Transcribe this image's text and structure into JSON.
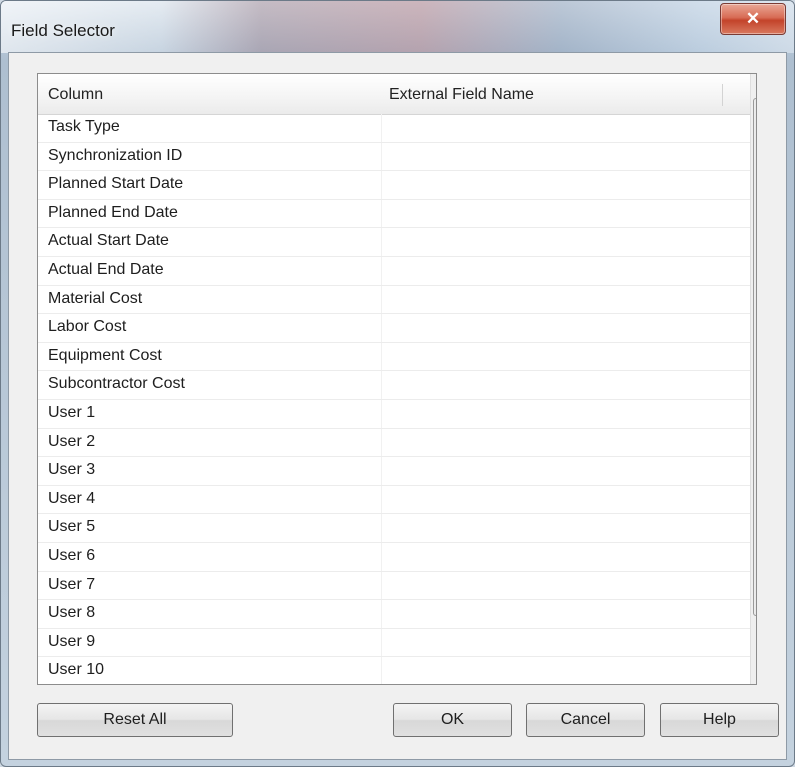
{
  "window": {
    "title": "Field Selector",
    "close_glyph": "✕"
  },
  "grid": {
    "columns": [
      "Column",
      "External Field Name"
    ],
    "rows": [
      [
        "Task Type",
        ""
      ],
      [
        "Synchronization ID",
        ""
      ],
      [
        "Planned Start Date",
        ""
      ],
      [
        "Planned End Date",
        ""
      ],
      [
        "Actual Start Date",
        ""
      ],
      [
        "Actual End Date",
        ""
      ],
      [
        "Material Cost",
        ""
      ],
      [
        "Labor Cost",
        ""
      ],
      [
        "Equipment Cost",
        ""
      ],
      [
        "Subcontractor Cost",
        ""
      ],
      [
        "User 1",
        ""
      ],
      [
        "User 2",
        ""
      ],
      [
        "User 3",
        ""
      ],
      [
        "User 4",
        ""
      ],
      [
        "User 5",
        ""
      ],
      [
        "User 6",
        ""
      ],
      [
        "User 7",
        ""
      ],
      [
        "User 8",
        ""
      ],
      [
        "User 9",
        ""
      ],
      [
        "User 10",
        ""
      ]
    ]
  },
  "scrollbar": {
    "up_glyph": "▲",
    "down_glyph": "▼"
  },
  "buttons": {
    "reset_all": "Reset All",
    "ok": "OK",
    "cancel": "Cancel",
    "help": "Help"
  },
  "icons": {
    "close": "close-icon",
    "scroll_up": "arrow-up-icon",
    "scroll_down": "arrow-down-icon",
    "grip": "grip-icon"
  },
  "colors": {
    "close_button": "#d05a42",
    "panel": "#f0f0f0",
    "grid_background": "#ffffff"
  }
}
